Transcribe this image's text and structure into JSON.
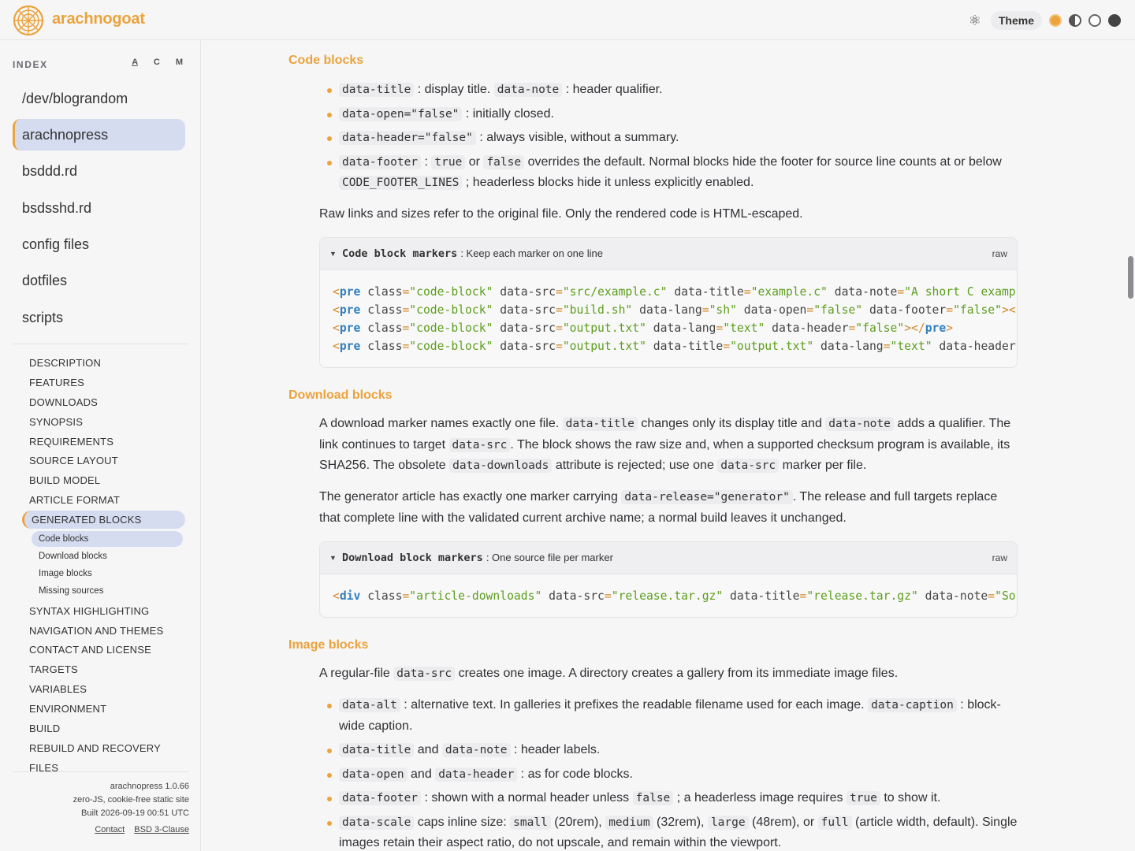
{
  "header": {
    "brand": "arachnogoat",
    "theme_label": "Theme",
    "theme_swatches": [
      "#eba33c",
      "#555555",
      "#777777",
      "#444444"
    ]
  },
  "sidebar": {
    "index_label": "INDEX",
    "sort_options": [
      "A",
      "C",
      "M"
    ],
    "projects": [
      "/dev/blograndom",
      "arachnopress",
      "bsddd.rd",
      "bsdsshd.rd",
      "config files",
      "dotfiles",
      "scripts"
    ],
    "active_project": "arachnopress",
    "toc": [
      "DESCRIPTION",
      "FEATURES",
      "DOWNLOADS",
      "SYNOPSIS",
      "REQUIREMENTS",
      "SOURCE LAYOUT",
      "BUILD MODEL",
      "ARTICLE FORMAT",
      "GENERATED BLOCKS",
      "SYNTAX HIGHLIGHTING",
      "NAVIGATION AND THEMES",
      "CONTACT AND LICENSE",
      "TARGETS",
      "VARIABLES",
      "ENVIRONMENT",
      "BUILD",
      "REBUILD AND RECOVERY",
      "FILES"
    ],
    "toc_sub": [
      "Code blocks",
      "Download blocks",
      "Image blocks",
      "Missing sources"
    ],
    "footer": {
      "version": "arachnopress 1.0.66",
      "tagline": "zero-JS, cookie-free static site",
      "built": "Built 2026-09-19 00:51 UTC",
      "contact": "Contact",
      "license": "BSD 3-Clause"
    }
  },
  "main": {
    "code": {
      "heading": "Code blocks",
      "b1a": "data-title",
      "b1b": ": display title.",
      "b1c": "data-note",
      "b1d": ": header qualifier.",
      "b2a": "data-open=\"false\"",
      "b2b": ": initially closed.",
      "b3a": "data-header=\"false\"",
      "b3b": ": always visible, without a summary.",
      "b4a": "data-footer",
      "b4b": ":",
      "b4c": "true",
      "b4d": "or",
      "b4e": "false",
      "b4f": "overrides the default. Normal blocks hide the footer for source line counts at or below",
      "b4g": "CODE_FOOTER_LINES",
      "b4h": "; headerless blocks hide it unless explicitly enabled.",
      "para": "Raw links and sizes refer to the original file. Only the rendered code is HTML-escaped.",
      "box_title": "Code block markers",
      "box_note": ": Keep each marker on one line",
      "box_raw": "raw"
    },
    "download": {
      "heading": "Download blocks",
      "p1a": "A download marker names exactly one file.",
      "p1b": "data-title",
      "p1c": "changes only its display title and",
      "p1d": "data-note",
      "p1e": "adds a qualifier.",
      "p1f": "The link continues to target",
      "p1g": "data-src",
      "p1h": ". The block shows the raw size and, when a supported checksum program is available, its SHA256. The obsolete",
      "p1i": "data-downloads",
      "p1j": "attribute is rejected; use one",
      "p1k": "data-src",
      "p1l": "marker per file.",
      "p2a": "The generator article has exactly one marker carrying",
      "p2b": "data-release=\"generator\"",
      "p2c": ". The release and full targets replace that complete line with the validated current archive name; a normal build leaves it unchanged.",
      "box_title": "Download block markers",
      "box_note": ": One source file per marker",
      "box_raw": "raw"
    },
    "image": {
      "heading": "Image blocks",
      "p1a": "A regular-file",
      "p1b": "data-src",
      "p1c": "creates one image. A directory creates a gallery from its immediate image files.",
      "b1a": "data-alt",
      "b1b": ": alternative text. In galleries it prefixes the readable filename used for each image.",
      "b1c": "data-caption",
      "b1d": ": block-wide caption.",
      "b2a": "data-title",
      "b2b": "and",
      "b2c": "data-note",
      "b2d": ": header labels.",
      "b3a": "data-open",
      "b3b": "and",
      "b3c": "data-header",
      "b3d": ": as for code blocks.",
      "b4a": "data-footer",
      "b4b": ": shown with a normal header unless",
      "b4c": "false",
      "b4d": "; a headerless image requires",
      "b4e": "true",
      "b4f": "to show it.",
      "b5a": "data-scale",
      "b5b": "caps inline size:",
      "b5c": "small",
      "b5d": "(20rem),",
      "b5e": "medium",
      "b5f": "(32rem),",
      "b5g": "large",
      "b5h": "(48rem), or",
      "b5i": "full",
      "b5j": "(article width, default). Single images retain their aspect ratio, do not upscale, and remain within the viewport."
    }
  },
  "code_lines": {
    "l1": [
      [
        "<",
        "pn"
      ],
      [
        "pre",
        "tg"
      ],
      [
        " class",
        "at"
      ],
      [
        "=",
        "pn"
      ],
      [
        "\"code-block\"",
        "st"
      ],
      [
        " data-src",
        "at"
      ],
      [
        "=",
        "pn"
      ],
      [
        "\"src/example.c\"",
        "st"
      ],
      [
        " data-title",
        "at"
      ],
      [
        "=",
        "pn"
      ],
      [
        "\"example.c\"",
        "st"
      ],
      [
        " data-note",
        "at"
      ],
      [
        "=",
        "pn"
      ],
      [
        "\"A short C examp",
        "st"
      ]
    ],
    "l2": [
      [
        "<",
        "pn"
      ],
      [
        "pre",
        "tg"
      ],
      [
        " class",
        "at"
      ],
      [
        "=",
        "pn"
      ],
      [
        "\"code-block\"",
        "st"
      ],
      [
        " data-src",
        "at"
      ],
      [
        "=",
        "pn"
      ],
      [
        "\"build.sh\"",
        "st"
      ],
      [
        " data-lang",
        "at"
      ],
      [
        "=",
        "pn"
      ],
      [
        "\"sh\"",
        "st"
      ],
      [
        " data-open",
        "at"
      ],
      [
        "=",
        "pn"
      ],
      [
        "\"false\"",
        "st"
      ],
      [
        " data-footer",
        "at"
      ],
      [
        "=",
        "pn"
      ],
      [
        "\"false\"",
        "st"
      ],
      [
        "><",
        "pn"
      ]
    ],
    "l3": [
      [
        "<",
        "pn"
      ],
      [
        "pre",
        "tg"
      ],
      [
        " class",
        "at"
      ],
      [
        "=",
        "pn"
      ],
      [
        "\"code-block\"",
        "st"
      ],
      [
        " data-src",
        "at"
      ],
      [
        "=",
        "pn"
      ],
      [
        "\"output.txt\"",
        "st"
      ],
      [
        " data-lang",
        "at"
      ],
      [
        "=",
        "pn"
      ],
      [
        "\"text\"",
        "st"
      ],
      [
        " data-header",
        "at"
      ],
      [
        "=",
        "pn"
      ],
      [
        "\"false\"",
        "st"
      ],
      [
        "></",
        "pn"
      ],
      [
        "pre",
        "tg"
      ],
      [
        ">",
        "pn"
      ]
    ],
    "l4": [
      [
        "<",
        "pn"
      ],
      [
        "pre",
        "tg"
      ],
      [
        " class",
        "at"
      ],
      [
        "=",
        "pn"
      ],
      [
        "\"code-block\"",
        "st"
      ],
      [
        " data-src",
        "at"
      ],
      [
        "=",
        "pn"
      ],
      [
        "\"output.txt\"",
        "st"
      ],
      [
        " data-title",
        "at"
      ],
      [
        "=",
        "pn"
      ],
      [
        "\"output.txt\"",
        "st"
      ],
      [
        " data-lang",
        "at"
      ],
      [
        "=",
        "pn"
      ],
      [
        "\"text\"",
        "st"
      ],
      [
        " data-header",
        "at"
      ]
    ],
    "d1": [
      [
        "<",
        "pn"
      ],
      [
        "div",
        "tg"
      ],
      [
        " class",
        "at"
      ],
      [
        "=",
        "pn"
      ],
      [
        "\"article-downloads\"",
        "st"
      ],
      [
        " data-src",
        "at"
      ],
      [
        "=",
        "pn"
      ],
      [
        "\"release.tar.gz\"",
        "st"
      ],
      [
        " data-title",
        "at"
      ],
      [
        "=",
        "pn"
      ],
      [
        "\"release.tar.gz\"",
        "st"
      ],
      [
        " data-note",
        "at"
      ],
      [
        "=",
        "pn"
      ],
      [
        "\"So",
        "st"
      ]
    ]
  }
}
